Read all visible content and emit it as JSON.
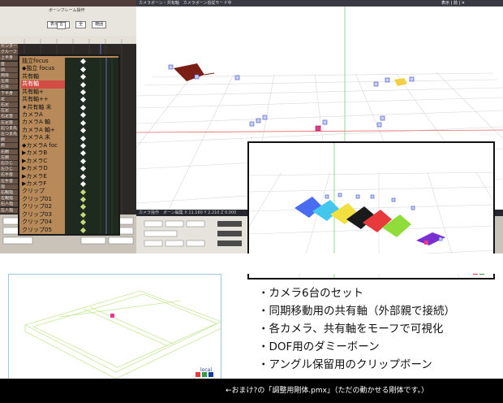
{
  "timeline": {
    "title": "ボーンフレーム操作",
    "buttons": [
      "表示設定",
      "全",
      "範囲"
    ],
    "frame_value": "0",
    "rows": [
      "センター",
      "グルーブ",
      "上半身",
      "首",
      "頭",
      "両目",
      "左目",
      "右目",
      "下半身",
      "足",
      "右足",
      "左足",
      "右足首",
      "左足首",
      "右つま先",
      "左つま先",
      "腕",
      "肩",
      "右腕",
      "左腕",
      "右ひじ",
      "左ひじ",
      "右手首",
      "左手首",
      "指",
      "右親指",
      "左親指",
      "右人指",
      "左人指"
    ]
  },
  "zoom": {
    "rows": [
      {
        "label": "独立focus",
        "selected": false
      },
      {
        "label": "◆独立 focus",
        "selected": false
      },
      {
        "label": "共有軸",
        "selected": false
      },
      {
        "label": "共有軸",
        "selected": true
      },
      {
        "label": "共有軸+",
        "selected": false
      },
      {
        "label": "共有軸++",
        "selected": false
      },
      {
        "label": "★共有軸 末",
        "selected": false
      },
      {
        "label": "カメラA",
        "selected": false
      },
      {
        "label": "カメラA 軸",
        "selected": false
      },
      {
        "label": "カメラA 軸+",
        "selected": false
      },
      {
        "label": "カメラA 末",
        "selected": false
      },
      {
        "label": "◆カメラA foc",
        "selected": false
      },
      {
        "label": "▶カメラB",
        "selected": false
      },
      {
        "label": "▶カメラC",
        "selected": false
      },
      {
        "label": "▶カメラD",
        "selected": false
      },
      {
        "label": "▶カメラE",
        "selected": false
      },
      {
        "label": "▶カメラF",
        "selected": false
      },
      {
        "label": "クリップ",
        "selected": false
      },
      {
        "label": "クリップ01",
        "selected": false
      },
      {
        "label": "クリップ02",
        "selected": false
      },
      {
        "label": "クリップ03",
        "selected": false
      },
      {
        "label": "クリップ04",
        "selected": false
      },
      {
        "label": "クリップ05",
        "selected": false
      }
    ]
  },
  "viewport": {
    "title": "カメラボーン・共有軸　カメラボーン追従モード中",
    "controls": "表示 | 前 | ✕",
    "status": "カメラ操作　ボーン編集 X 11.160 Y 2.210 Z 0.000",
    "local_label": "local"
  },
  "inset": {
    "local_label": "local"
  },
  "stage": {
    "local_label": "local"
  },
  "bullets": [
    "・カメラ6台のセット",
    "・同期移動用の共有軸（外部親で接続）",
    "・各カメラ、共有軸をモーフで可視化",
    "・DOF用のダミーボーン",
    "・アングル保留用のクリップボーン"
  ],
  "footer_note": "←おまけ?の「調整用剛体.pmx」（ただの動かせる剛体です。）",
  "colors": {
    "accent_red": "#d24e44",
    "grid_green": "#7fd87f",
    "axis_blue": "#1a3a9c",
    "camera_colors": [
      "#4a6cf0",
      "#43c7f0",
      "#f2e040",
      "#f08a30",
      "#e83a3a",
      "#8fdc3a",
      "#7a2fd0"
    ]
  }
}
